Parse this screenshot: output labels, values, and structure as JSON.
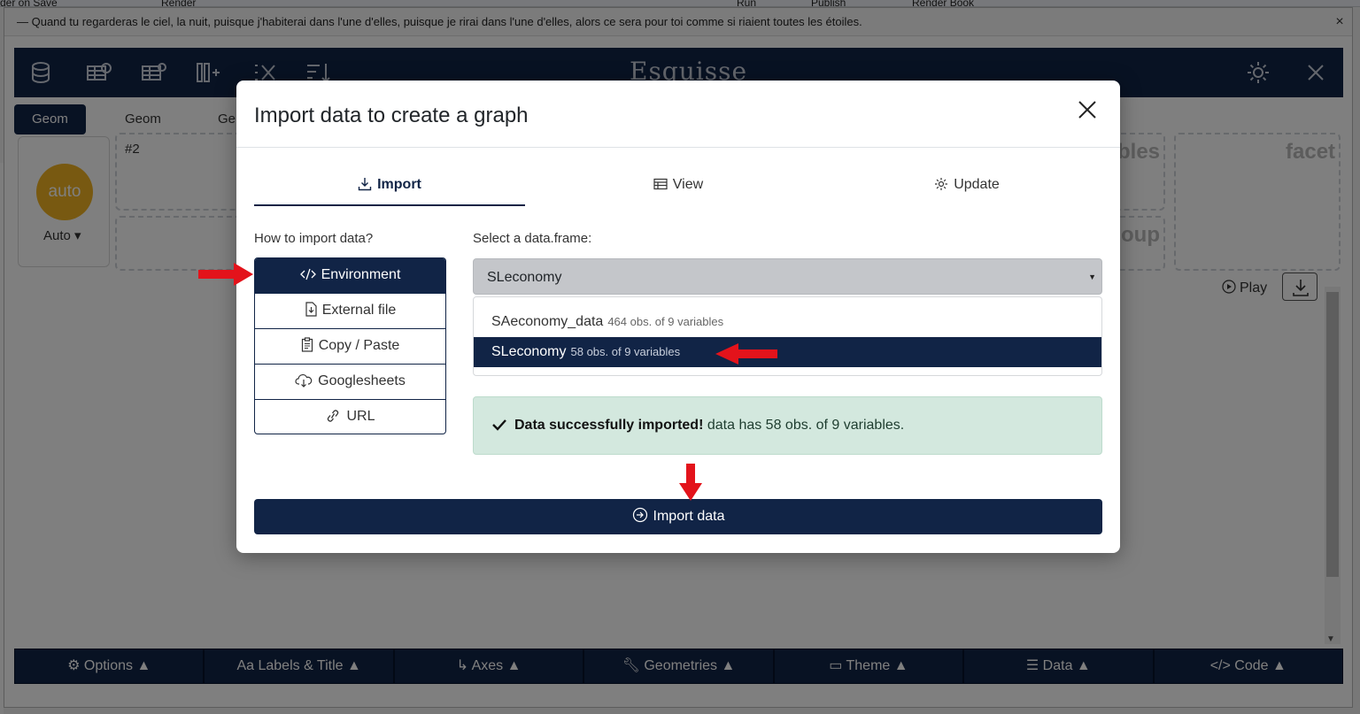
{
  "rstudio_toolbar": {
    "items": [
      "der on Save",
      "Render",
      "Run",
      "Publish",
      "Render Book"
    ]
  },
  "quote_bar": {
    "text": "— Quand tu regarderas le ciel, la nuit, puisque j'habiterai dans l'une d'elles, puisque je rirai dans l'une d'elles, alors ce sera pour toi comme si riaient toutes les étoiles.",
    "close": "×"
  },
  "app": {
    "brand": "Esquisse",
    "geom_tabs": [
      "Geom #1",
      "Geom #2",
      "Ge"
    ],
    "geom_selector": {
      "circle_text": "auto",
      "label": "Auto"
    },
    "ghost_labels": {
      "variables": "bles",
      "facet": "facet",
      "group": "oup"
    },
    "play_label": "Play",
    "bottom_bar": [
      "Options",
      "Labels & Title",
      "Axes",
      "Geometries",
      "Theme",
      "Data",
      "Code"
    ]
  },
  "modal": {
    "title": "Import data to create a graph",
    "tabs": [
      {
        "label": "Import",
        "icon": "download-icon",
        "active": true
      },
      {
        "label": "View",
        "icon": "table-icon",
        "active": false
      },
      {
        "label": "Update",
        "icon": "gear-icon",
        "active": false
      }
    ],
    "how_label": "How to import data?",
    "methods": [
      {
        "label": "Environment",
        "icon": "code-icon",
        "active": true
      },
      {
        "label": "External file",
        "icon": "file-import-icon",
        "active": false
      },
      {
        "label": "Copy / Paste",
        "icon": "clipboard-icon",
        "active": false
      },
      {
        "label": "Googlesheets",
        "icon": "cloud-download-icon",
        "active": false
      },
      {
        "label": "URL",
        "icon": "link-icon",
        "active": false
      }
    ],
    "select_label": "Select a data.frame:",
    "selected_value": "SLeconomy",
    "options": [
      {
        "name": "SAeconomy_data",
        "detail": "464 obs. of 9 variables",
        "selected": false
      },
      {
        "name": "SLeconomy",
        "detail": "58 obs. of 9 variables",
        "selected": true
      }
    ],
    "alert": {
      "bold": "Data successfully imported!",
      "text": " data has 58 obs. of 9 variables."
    },
    "import_button": "Import data"
  },
  "colors": {
    "navy": "#112446",
    "success_bg": "#d3e8de",
    "annotation_red": "#e3131b",
    "auto_yellow": "#f0b323"
  }
}
